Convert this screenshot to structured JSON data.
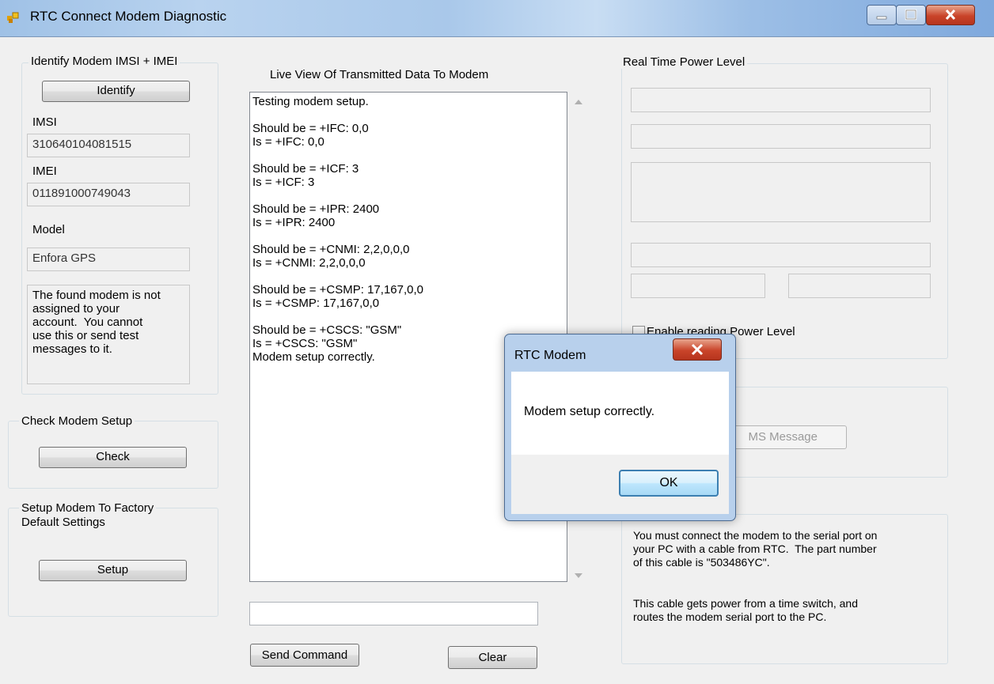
{
  "window": {
    "title": "RTC Connect Modem Diagnostic"
  },
  "identify": {
    "legend": "Identify Modem IMSI + IMEI",
    "button": "Identify",
    "imsi_label": "IMSI",
    "imsi_value": "310640104081515",
    "imei_label": "IMEI",
    "imei_value": "011891000749043",
    "model_label": "Model",
    "model_value": "Enfora GPS",
    "note": "The found modem is not\nassigned to your\naccount.  You cannot\nuse this or send test\nmessages to it."
  },
  "check": {
    "legend": "Check Modem Setup",
    "button": "Check"
  },
  "factory": {
    "legend": "Setup Modem To Factory\nDefault Settings",
    "button": "Setup"
  },
  "live": {
    "heading": "Live View Of Transmitted Data To Modem",
    "log": "Testing modem setup.\n\nShould be = +IFC: 0,0\nIs = +IFC: 0,0\n\nShould be = +ICF: 3\nIs = +ICF: 3\n\nShould be = +IPR: 2400\nIs = +IPR: 2400\n\nShould be = +CNMI: 2,2,0,0,0\nIs = +CNMI: 2,2,0,0,0\n\nShould be = +CSMP: 17,167,0,0\nIs = +CSMP: 17,167,0,0\n\nShould be = +CSCS: \"GSM\"\nIs = +CSCS: \"GSM\"\nModem setup correctly.",
    "command_value": "",
    "send_button": "Send Command",
    "clear_button": "Clear"
  },
  "power": {
    "legend": "Real Time Power Level",
    "enable_label": "Enable reading Power Level",
    "enable_checked": false
  },
  "sms": {
    "button_partial": "MS Message"
  },
  "info": {
    "text1": "You must connect the modem to the serial port on\nyour PC with a cable from RTC.  The part number\nof this cable is \"503486YC\".",
    "text2": "This cable gets power from a time switch, and\nroutes the modem serial port to the PC."
  },
  "dialog": {
    "title": "RTC Modem",
    "message": "Modem setup correctly.",
    "ok": "OK"
  },
  "icons": [
    "app-icon",
    "minimize-icon",
    "maximize-icon",
    "close-icon",
    "scroll-up-arrow-icon",
    "scroll-down-arrow-icon"
  ]
}
